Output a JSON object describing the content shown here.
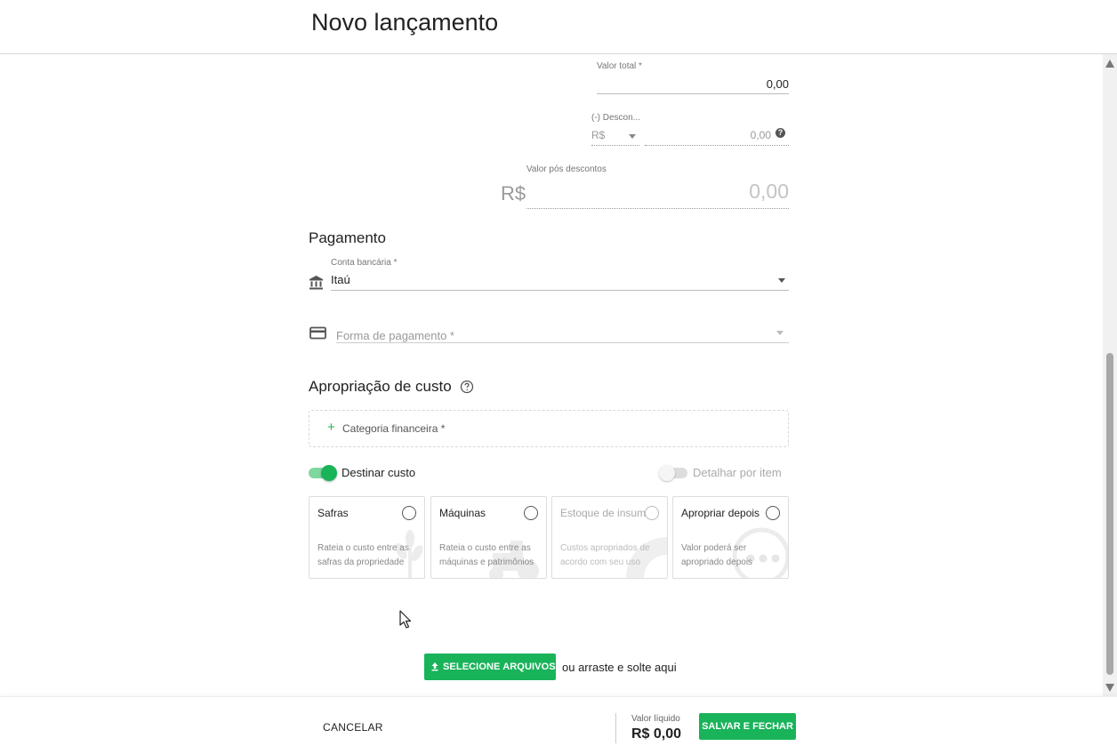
{
  "header": {
    "title": "Novo lançamento"
  },
  "valores": {
    "valor_total_label": "Valor total *",
    "valor_total_value": "0,00",
    "desconto_label": "(-) Descon...",
    "desconto_currency": "R$",
    "desconto_value": "0,00",
    "pos_descontos_label": "Valor pós descontos",
    "pos_descontos_currency": "R$",
    "pos_descontos_value": "0,00"
  },
  "pagamento": {
    "title": "Pagamento",
    "conta_label": "Conta bancária *",
    "conta_value": "Itaú",
    "forma_placeholder": "Forma de pagamento *"
  },
  "apropriacao": {
    "title": "Apropriação de custo",
    "categoria_label": "Categoria financeira *",
    "destinar_label": "Destinar custo",
    "destinar_on": true,
    "detalhar_label": "Detalhar por item",
    "detalhar_on": false,
    "cards": [
      {
        "title": "Safras",
        "desc": "Rateia o custo entre as safras da propriedade",
        "disabled": false
      },
      {
        "title": "Máquinas",
        "desc": "Rateia o custo entre as máquinas e patrimônios",
        "disabled": false
      },
      {
        "title": "Estoque de insumos",
        "desc": "Custos apropriados de acordo com seu uso",
        "disabled": true
      },
      {
        "title": "Apropriar depois",
        "desc": "Valor poderá ser apropriado depois",
        "disabled": false
      }
    ]
  },
  "upload": {
    "button_label": "SELECIONE ARQUIVOS",
    "hint": "ou arraste e solte aqui"
  },
  "footer": {
    "cancel_label": "CANCELAR",
    "valor_liquido_label": "Valor líquido",
    "valor_liquido_value": "R$ 0,00",
    "save_label": "SALVAR E FECHAR"
  },
  "colors": {
    "accent": "#19b35a"
  }
}
